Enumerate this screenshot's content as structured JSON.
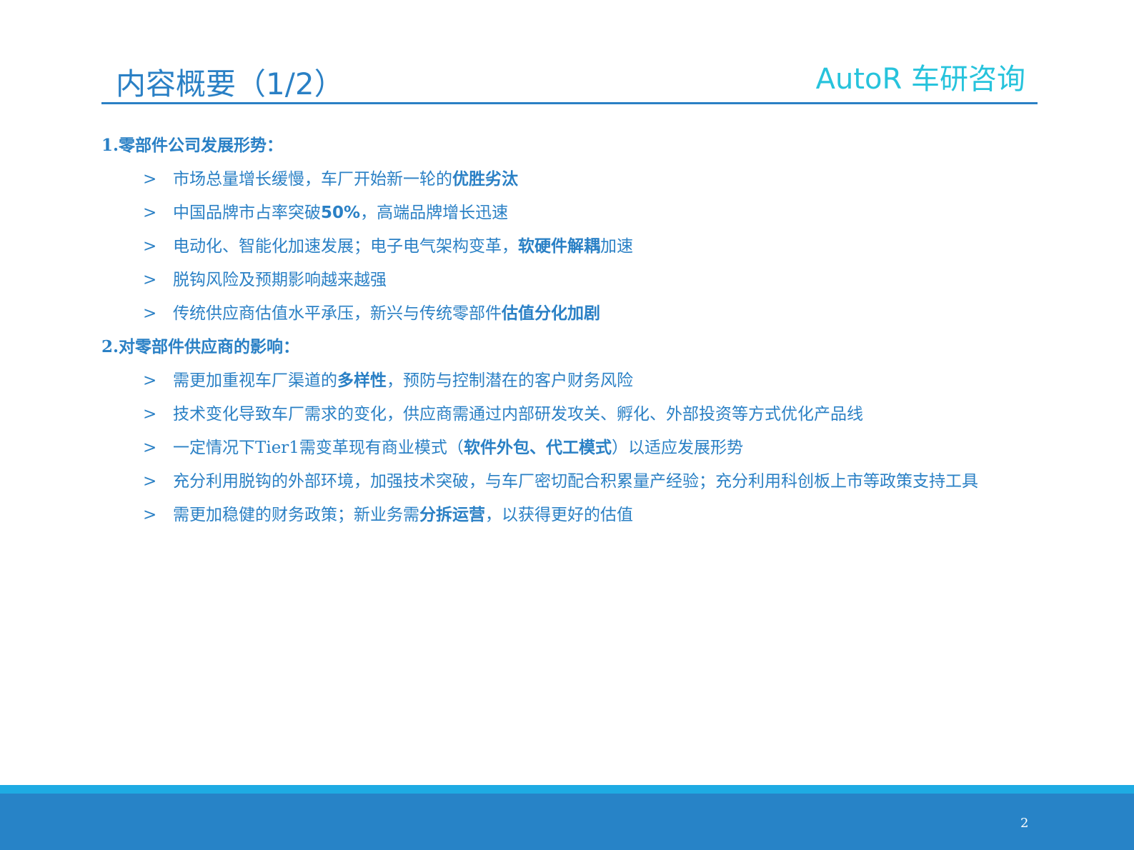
{
  "header": {
    "title": "内容概要（1/2）",
    "brand": "AutoR 车研咨询"
  },
  "sections": [
    {
      "heading": "1.零部件公司发展形势：",
      "items": [
        [
          {
            "t": "市场总量增长缓慢，车厂开始新一轮的"
          },
          {
            "t": "优胜劣汰",
            "b": true
          }
        ],
        [
          {
            "t": "中国品牌市占率突破"
          },
          {
            "t": "50%",
            "b": true
          },
          {
            "t": "，高端品牌增长迅速"
          }
        ],
        [
          {
            "t": "电动化、智能化加速发展；电子电气架构变革，"
          },
          {
            "t": "软硬件解耦",
            "b": true
          },
          {
            "t": "加速"
          }
        ],
        [
          {
            "t": "脱钩风险及预期影响越来越强"
          }
        ],
        [
          {
            "t": "传统供应商估值水平承压，新兴与传统零部件"
          },
          {
            "t": "估值分化加剧",
            "b": true
          }
        ]
      ]
    },
    {
      "heading": "2.对零部件供应商的影响：",
      "items": [
        [
          {
            "t": "需更加重视车厂渠道的"
          },
          {
            "t": "多样性",
            "b": true
          },
          {
            "t": "，预防与控制潜在的客户财务风险"
          }
        ],
        [
          {
            "t": "技术变化导致车厂需求的变化，供应商需通过内部研发攻关、孵化、外部投资等方式优化产品线"
          }
        ],
        [
          {
            "t": "一定情况下Tier1需变革现有商业模式（"
          },
          {
            "t": "软件外包、代工模式",
            "b": true
          },
          {
            "t": "）以适应发展形势"
          }
        ],
        [
          {
            "t": "充分利用脱钩的外部环境，加强技术突破，与车厂密切配合积累量产经验；充分利用科创板上市等政策支持工具"
          }
        ],
        [
          {
            "t": "需更加稳健的财务政策；新业务需"
          },
          {
            "t": "分拆运营",
            "b": true
          },
          {
            "t": "，以获得更好的估值"
          }
        ]
      ]
    }
  ],
  "bullet_glyph": ">",
  "footer": {
    "page": "2"
  }
}
